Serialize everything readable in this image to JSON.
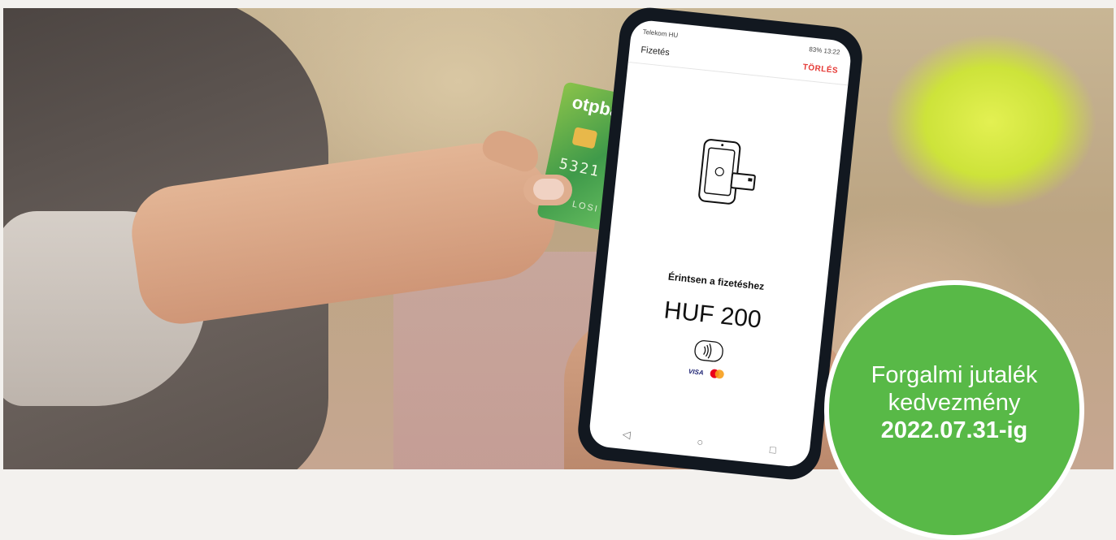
{
  "phone": {
    "status_left": "Telekom HU",
    "status_right": "83% 13:22",
    "app_title": "Fizetés",
    "cancel_label": "TÖRLÉS",
    "prompt": "Érintsen a fizetéshez",
    "amount": "HUF 200",
    "visa_label": "VISA",
    "nav": {
      "back": "◁",
      "home": "○",
      "recent": "□"
    }
  },
  "card": {
    "logo": "otpbank",
    "number": "5321 80",
    "name": "LOSI BENE"
  },
  "badge": {
    "line1": "Forgalmi jutalék",
    "line2": "kedvezmény",
    "line3": "2022.07.31-ig",
    "color": "#58b947"
  },
  "icons": [
    "tap-to-pay-illustration",
    "contactless-icon",
    "mastercard-icon"
  ]
}
